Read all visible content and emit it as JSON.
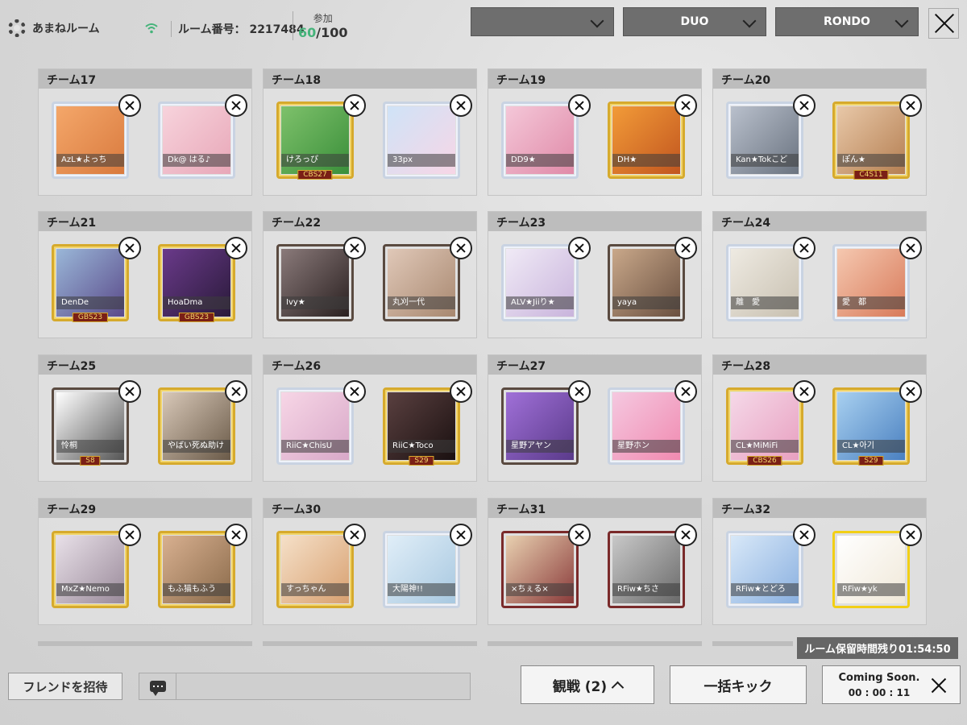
{
  "header": {
    "room_name": "あまねルーム",
    "room_number": "ルーム番号： 2217484",
    "participants_label": "参加",
    "participants_current": "60",
    "participants_max": "/100",
    "dropdown_1": "",
    "dropdown_2": "DUO",
    "dropdown_3": "RONDO"
  },
  "colors": {
    "accent_green": "#45b37a",
    "header_bg": "#bdbdbd",
    "dropdown_bg": "#6e6e6e"
  },
  "teams": [
    {
      "title": "チーム17",
      "players": [
        {
          "name": "AzL★よっち",
          "badge": ""
        },
        {
          "name": "Dk@ はる♪",
          "badge": ""
        }
      ]
    },
    {
      "title": "チーム18",
      "players": [
        {
          "name": "けろっぴ",
          "badge": "CBS27"
        },
        {
          "name": "33px",
          "badge": ""
        }
      ]
    },
    {
      "title": "チーム19",
      "players": [
        {
          "name": "DD9★",
          "badge": ""
        },
        {
          "name": "DH★",
          "badge": ""
        }
      ]
    },
    {
      "title": "チーム20",
      "players": [
        {
          "name": "Kan★Tokこど",
          "badge": ""
        },
        {
          "name": "ぽん★",
          "badge": "C4S11"
        }
      ]
    },
    {
      "title": "チーム21",
      "players": [
        {
          "name": "DenDe",
          "badge": "GBS23"
        },
        {
          "name": "HoaDma",
          "badge": "GBS23"
        }
      ]
    },
    {
      "title": "チーム22",
      "players": [
        {
          "name": "Ivy★",
          "badge": ""
        },
        {
          "name": "丸刈一代",
          "badge": ""
        }
      ]
    },
    {
      "title": "チーム23",
      "players": [
        {
          "name": "ALV★Jiiり★",
          "badge": ""
        },
        {
          "name": "yaya",
          "badge": ""
        }
      ]
    },
    {
      "title": "チーム24",
      "players": [
        {
          "name": "離　愛",
          "badge": ""
        },
        {
          "name": "愛　都",
          "badge": ""
        }
      ]
    },
    {
      "title": "チーム25",
      "players": [
        {
          "name": "怜桐",
          "badge": "S8"
        },
        {
          "name": "やばい死ぬ助け",
          "badge": ""
        }
      ]
    },
    {
      "title": "チーム26",
      "players": [
        {
          "name": "RiiC★ChisU",
          "badge": ""
        },
        {
          "name": "RiiC★Toco",
          "badge": "S29"
        }
      ]
    },
    {
      "title": "チーム27",
      "players": [
        {
          "name": "星野アヤン",
          "badge": ""
        },
        {
          "name": "星野ホン",
          "badge": ""
        }
      ]
    },
    {
      "title": "チーム28",
      "players": [
        {
          "name": "CL★MiMiFi",
          "badge": "CBS26"
        },
        {
          "name": "CL★아기",
          "badge": "S29"
        }
      ]
    },
    {
      "title": "チーム29",
      "players": [
        {
          "name": "MxZ★Nemo",
          "badge": ""
        },
        {
          "name": "もふ猫もふう",
          "badge": ""
        }
      ]
    },
    {
      "title": "チーム30",
      "players": [
        {
          "name": "すっちゃん",
          "badge": ""
        },
        {
          "name": "大陽神!!",
          "badge": ""
        }
      ]
    },
    {
      "title": "チーム31",
      "players": [
        {
          "name": "×ちぇる×",
          "badge": ""
        },
        {
          "name": "RFiw★ちさ",
          "badge": ""
        }
      ]
    },
    {
      "title": "チーム32",
      "players": [
        {
          "name": "RFiw★とどろ",
          "badge": ""
        },
        {
          "name": "RFiw★yk",
          "badge": ""
        }
      ]
    }
  ],
  "footer": {
    "invite_label": "フレンドを招待",
    "spectate_label": "観戦 (2)",
    "kick_label": "一括キック",
    "reserve_time": "ルーム保留時間残り01:54:50",
    "coming_soon": "Coming Soon.",
    "coming_timer": "00 : 00 : 11"
  }
}
